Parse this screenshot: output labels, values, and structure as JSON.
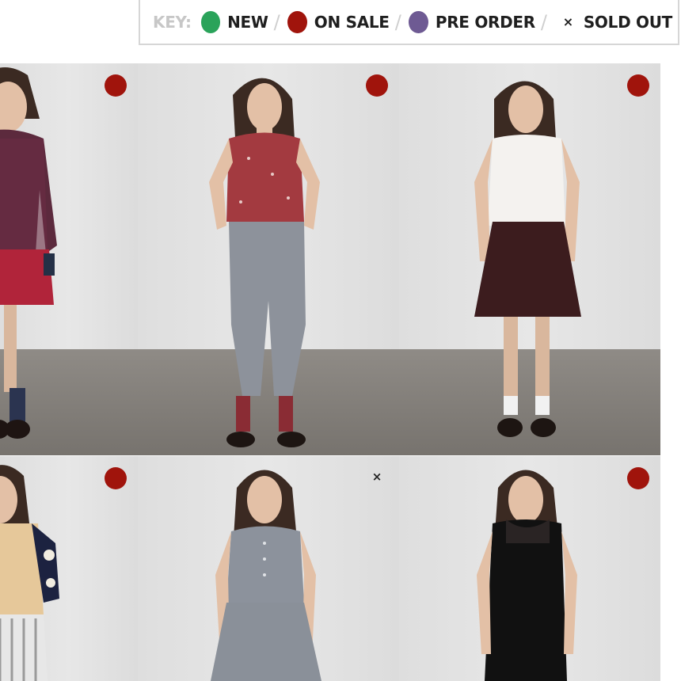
{
  "key": {
    "label": "KEY:",
    "items": [
      {
        "text": "NEW",
        "color": "#2aa35a"
      },
      {
        "text": "ON SALE",
        "color": "#a0140c"
      },
      {
        "text": "PRE ORDER",
        "color": "#6e5a93"
      },
      {
        "text": "SOLD OUT",
        "symbol": "×"
      }
    ],
    "separator": "/"
  },
  "products": [
    {
      "status": "on-sale",
      "status_color": "#a0140c",
      "outfit": "floral blouse, red skirt"
    },
    {
      "status": "on-sale",
      "status_color": "#a0140c",
      "outfit": "red sleeveless polka blouse, grey trousers"
    },
    {
      "status": "on-sale",
      "status_color": "#a0140c",
      "outfit": "white sleeveless top, burgundy skirt"
    },
    {
      "status": "on-sale",
      "status_color": "#a0140c",
      "outfit": "printed blouse, striped trousers"
    },
    {
      "status": "sold-out",
      "status_symbol": "×",
      "outfit": "grey sleeveless dress"
    },
    {
      "status": "on-sale",
      "status_color": "#a0140c",
      "outfit": "black sleeveless dress"
    }
  ]
}
